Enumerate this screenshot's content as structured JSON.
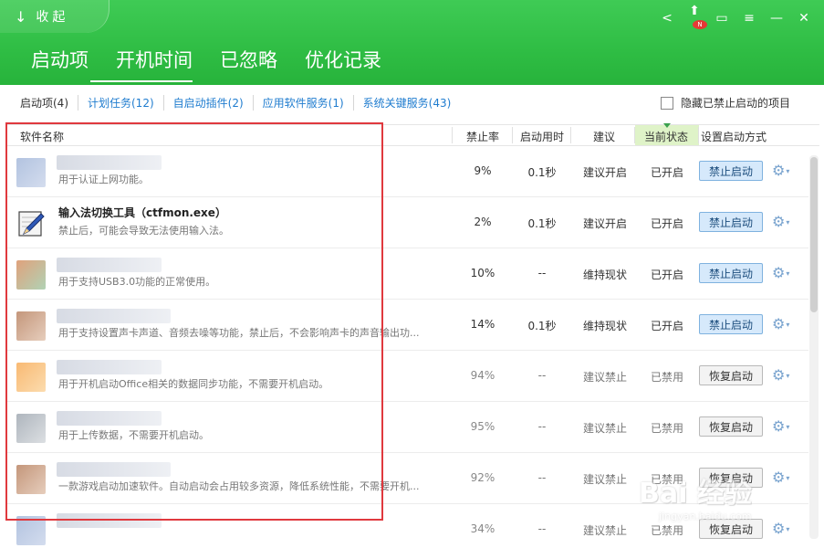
{
  "header": {
    "collapse_label": "收起",
    "main_tabs": [
      {
        "label": "启动项"
      },
      {
        "label": "开机时间"
      },
      {
        "label": "已忽略"
      },
      {
        "label": "优化记录"
      }
    ],
    "notification_badge": "N"
  },
  "subtabs": [
    {
      "label": "启动项(4)"
    },
    {
      "label": "计划任务(12)"
    },
    {
      "label": "自启动插件(2)"
    },
    {
      "label": "应用软件服务(1)"
    },
    {
      "label": "系统关键服务(43)"
    }
  ],
  "hide_option_label": "隐藏已禁止启动的项目",
  "columns": {
    "name": "软件名称",
    "rate": "禁止率",
    "time": "启动用时",
    "suggestion": "建议",
    "status": "当前状态",
    "method": "设置启动方式"
  },
  "rows": [
    {
      "name": "",
      "desc": "用于认证上网功能。",
      "rate": "9%",
      "time": "0.1秒",
      "suggestion": "建议开启",
      "status": "已开启",
      "action": "禁止启动"
    },
    {
      "name": "输入法切换工具（ctfmon.exe）",
      "desc": "禁止后，可能会导致无法使用输入法。",
      "rate": "2%",
      "time": "0.1秒",
      "suggestion": "建议开启",
      "status": "已开启",
      "action": "禁止启动"
    },
    {
      "name": "",
      "desc": "用于支持USB3.0功能的正常使用。",
      "rate": "10%",
      "time": "--",
      "suggestion": "维持现状",
      "status": "已开启",
      "action": "禁止启动"
    },
    {
      "name": "",
      "desc": "用于支持设置声卡声道、音频去噪等功能，禁止后，不会影响声卡的声音输出功...",
      "rate": "14%",
      "time": "0.1秒",
      "suggestion": "维持现状",
      "status": "已开启",
      "action": "禁止启动"
    },
    {
      "name": "",
      "desc": "用于开机启动Office相关的数据同步功能，不需要开机启动。",
      "rate": "94%",
      "time": "--",
      "suggestion": "建议禁止",
      "status": "已禁用",
      "action": "恢复启动"
    },
    {
      "name": "",
      "desc": "用于上传数据，不需要开机启动。",
      "rate": "95%",
      "time": "--",
      "suggestion": "建议禁止",
      "status": "已禁用",
      "action": "恢复启动"
    },
    {
      "name": "",
      "desc": "一款游戏启动加速软件。自动启动会占用较多资源，降低系统性能，不需要开机...",
      "rate": "92%",
      "time": "--",
      "suggestion": "建议禁止",
      "status": "已禁用",
      "action": "恢复启动"
    },
    {
      "name": "",
      "desc": "",
      "rate": "34%",
      "time": "--",
      "suggestion": "建议禁止",
      "status": "已禁用",
      "action": "恢复启动"
    }
  ],
  "watermark": {
    "text": "Bai 经验",
    "sub": "jingyan.baidu.com"
  }
}
